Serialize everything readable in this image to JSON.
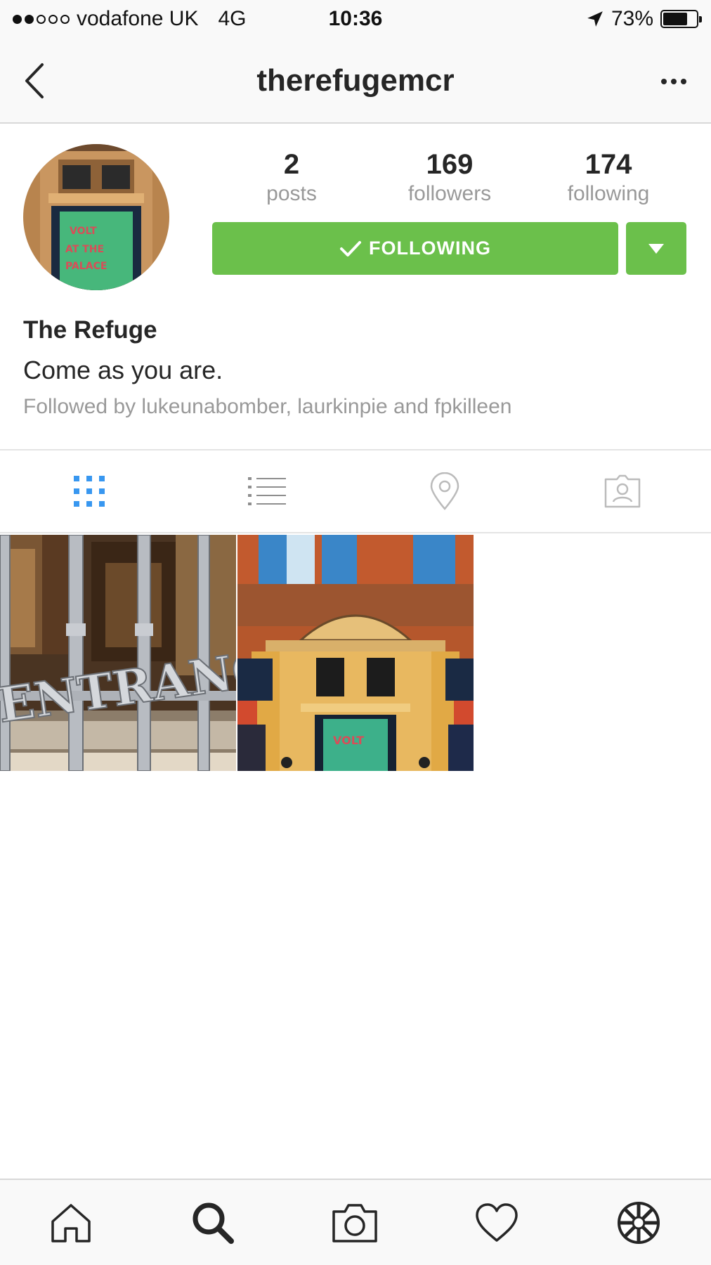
{
  "status_bar": {
    "carrier": "vodafone UK",
    "network": "4G",
    "time": "10:36",
    "battery_percent": "73%",
    "signal_strength": 2,
    "signal_max": 5,
    "battery_level": 0.73,
    "icons": [
      "location-arrow-icon",
      "battery-icon"
    ]
  },
  "header": {
    "title": "therefugemcr",
    "icons": [
      "back-chevron-icon",
      "more-options-icon"
    ]
  },
  "profile": {
    "stats": [
      {
        "value": "2",
        "label": "posts"
      },
      {
        "value": "169",
        "label": "followers"
      },
      {
        "value": "174",
        "label": "following"
      }
    ],
    "follow_button_label": "FOLLOWING",
    "display_name": "The Refuge",
    "bio": "Come as you are.",
    "followed_by": "Followed by lukeunabomber, laurkinpie and fpkilleen",
    "accent_color": "#6bc04b"
  },
  "tabs": [
    {
      "name": "grid-view",
      "icon": "grid-icon",
      "active": true
    },
    {
      "name": "list-view",
      "icon": "list-icon",
      "active": false
    },
    {
      "name": "location-view",
      "icon": "location-pin-icon",
      "active": false
    },
    {
      "name": "tagged-view",
      "icon": "tagged-person-icon",
      "active": false
    }
  ],
  "posts": {
    "photo_1_text": "ENTRANCE",
    "photo_2_sign_text": "VOLT"
  },
  "bottom_nav": [
    {
      "name": "home",
      "icon": "home-icon"
    },
    {
      "name": "search",
      "icon": "search-icon",
      "active": true
    },
    {
      "name": "camera",
      "icon": "camera-icon"
    },
    {
      "name": "activity",
      "icon": "heart-icon"
    },
    {
      "name": "profile",
      "icon": "profile-avatar-icon"
    }
  ]
}
